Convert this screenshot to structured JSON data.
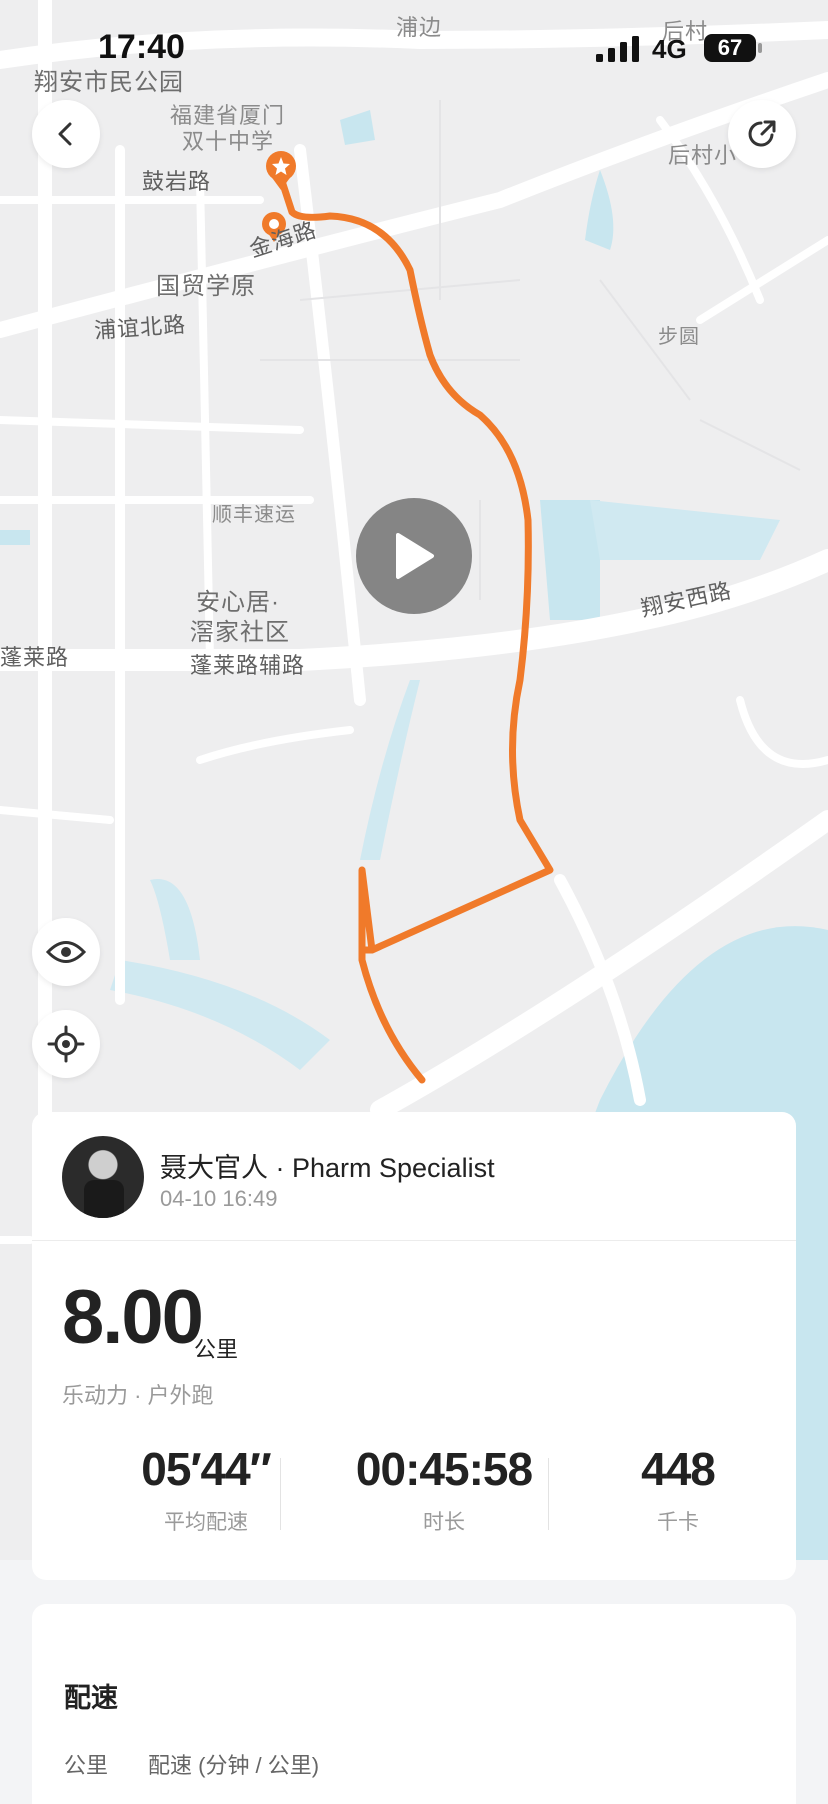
{
  "status_bar": {
    "time": "17:40",
    "network": "4G",
    "battery": "67"
  },
  "map": {
    "labels": {
      "l1": "浦边",
      "l2": "后村",
      "l3": "翔安市民公园",
      "l4": "福建省厦门",
      "l5": "双十中学",
      "l6": "鼓岩路",
      "l7": "后村小",
      "l8": "金海路",
      "l9": "国贸学原",
      "l10": "浦谊北路",
      "l11": "步圆",
      "l12": "顺丰速运",
      "l13": "安心居·",
      "l14": "滘家社区",
      "l15": "蓬莱路",
      "l16": "蓬莱路辅路",
      "l17": "翔安西路"
    },
    "icons": {
      "back": "chevron-left-icon",
      "share": "share-icon",
      "eye": "eye-icon",
      "locate": "locate-icon",
      "play": "play-icon"
    },
    "route_color": "#f07a2a"
  },
  "summary": {
    "user_name": "聂大官人 · Pharm Specialist",
    "date": "04-10 16:49",
    "distance": "8.00",
    "distance_unit": "公里",
    "sport": "乐动力 · 户外跑",
    "stats": [
      {
        "value": "05′44″",
        "label": "平均配速"
      },
      {
        "value": "00:45:58",
        "label": "时长"
      },
      {
        "value": "448",
        "label": "千卡"
      }
    ]
  },
  "pace": {
    "title": "配速",
    "col1": "公里",
    "col2": "配速 (分钟 / 公里)"
  }
}
